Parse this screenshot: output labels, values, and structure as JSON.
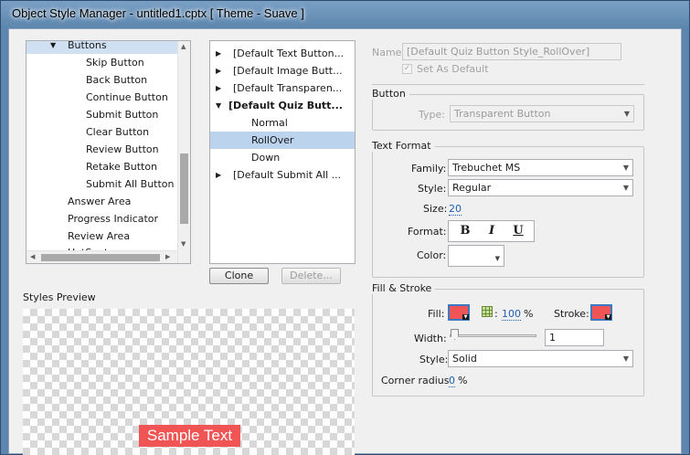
{
  "window": {
    "title": "Object Style Manager - untitled1.cptx [ Theme - Suave ]"
  },
  "tree": {
    "items": [
      {
        "label": "Buttons",
        "selected": true
      },
      {
        "label": "Skip Button"
      },
      {
        "label": "Back Button"
      },
      {
        "label": "Continue Button"
      },
      {
        "label": "Submit Button"
      },
      {
        "label": "Clear Button"
      },
      {
        "label": "Review Button"
      },
      {
        "label": "Retake Button"
      },
      {
        "label": "Submit All Button"
      },
      {
        "label": "Answer Area"
      },
      {
        "label": "Progress Indicator"
      },
      {
        "label": "Review Area"
      },
      {
        "label": "HotSpot"
      }
    ]
  },
  "styles_list": {
    "items": [
      {
        "label": "[Default Text Button..."
      },
      {
        "label": "[Default Image Butt..."
      },
      {
        "label": "[Default Transparen..."
      },
      {
        "label": "[Default Quiz Butt..."
      },
      {
        "label": "Normal"
      },
      {
        "label": "RollOver",
        "selected": true
      },
      {
        "label": "Down"
      },
      {
        "label": "[Default Submit All ..."
      }
    ],
    "clone_label": "Clone",
    "delete_label": "Delete..."
  },
  "preview": {
    "heading": "Styles Preview",
    "sample_text": "Sample Text",
    "sample_color": "#f05454"
  },
  "properties": {
    "name_label": "Name",
    "name_value": "[Default Quiz Button Style_RollOver]",
    "set_default_label": "Set As Default",
    "button_group": "Button",
    "type_label": "Type:",
    "type_value": "Transparent Button",
    "text_format_group": "Text Format",
    "family_label": "Family:",
    "family_value": "Trebuchet MS",
    "style_label": "Style:",
    "style_value": "Regular",
    "size_label": "Size:",
    "size_value": "20",
    "format_label": "Format:",
    "format_bold": "B",
    "format_italic": "I",
    "format_underline": "U",
    "color_label": "Color:",
    "fill_stroke_group": "Fill & Stroke",
    "fill_label": "Fill:",
    "fill_color": "#f05454",
    "fill_opacity": "100",
    "percent": "%",
    "stroke_label": "Stroke:",
    "stroke_color": "#f05454",
    "width_label": "Width:",
    "width_value": "1",
    "stroke_style_label": "Style:",
    "stroke_style_value": "Solid",
    "corner_radius_label": "Corner radius",
    "corner_radius_value": "0",
    "corner_radius_unit": "%"
  }
}
